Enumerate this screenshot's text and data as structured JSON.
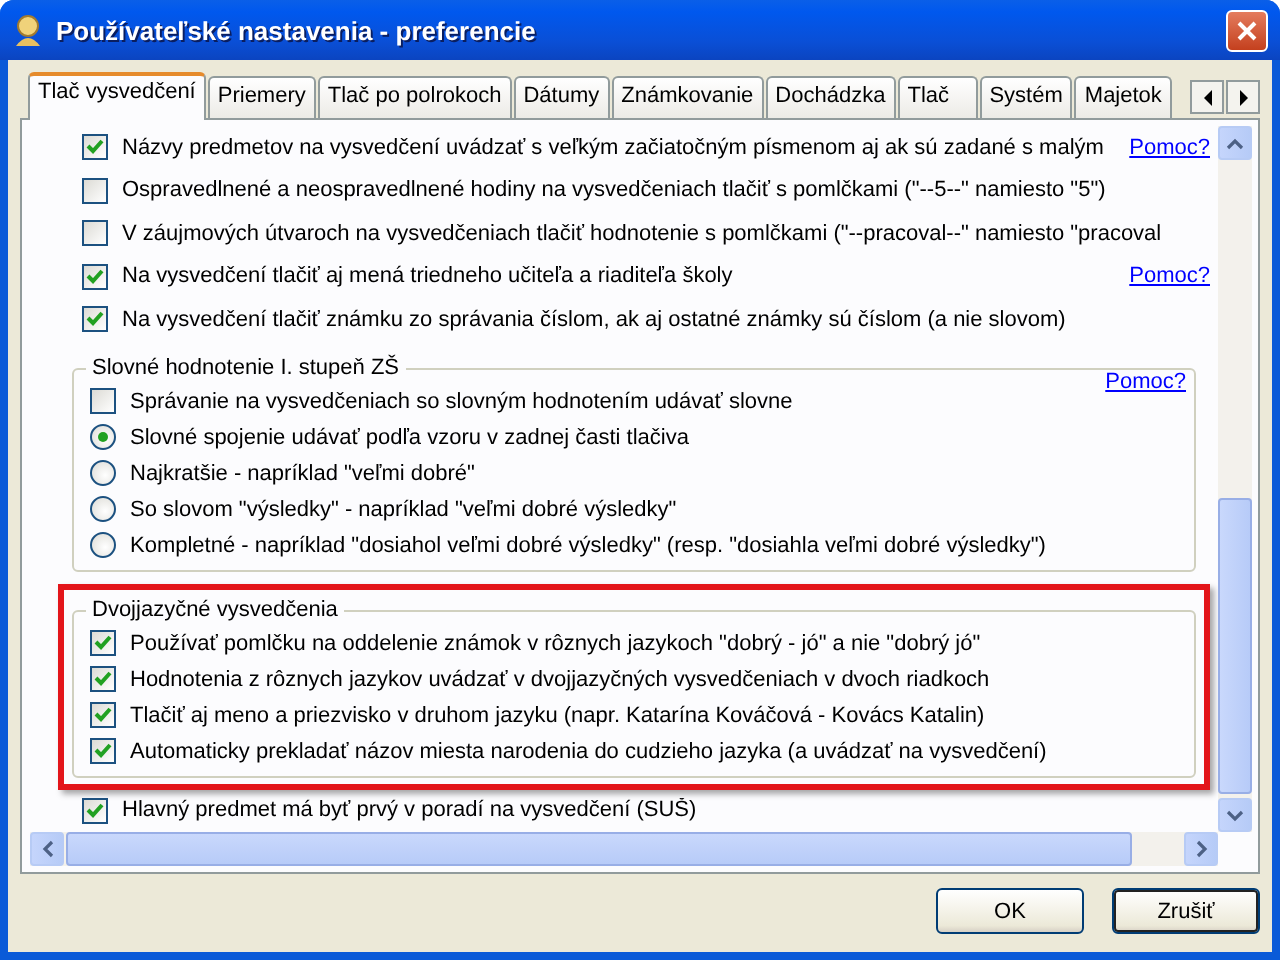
{
  "window": {
    "title": "Používateľské nastavenia - preferencie"
  },
  "tabs": [
    {
      "label": "Tlač vysvedčení",
      "selected": true
    },
    {
      "label": "Priemery",
      "selected": false
    },
    {
      "label": "Tlač po polrokoch",
      "selected": false
    },
    {
      "label": "Dátumy",
      "selected": false
    },
    {
      "label": "Známkovanie",
      "selected": false
    },
    {
      "label": "Dochádzka",
      "selected": false
    },
    {
      "label": "Tlač",
      "selected": false
    },
    {
      "label": "Systém",
      "selected": false
    },
    {
      "label": "Majetok",
      "selected": false
    }
  ],
  "sections": [
    {
      "kind": "plain",
      "items": [
        {
          "kind": "checkbox",
          "label": "Názvy predmetov na vysvedčení uvádzať s veľkým začiatočným písmenom aj ak sú zadané s malým",
          "checked": true,
          "help": "Pomoc?"
        },
        {
          "kind": "checkbox",
          "label": "Ospravedlnené a neospravedlnené hodiny na vysvedčeniach tlačiť s pomlčkami (\"--5--\" namiesto \"5\")",
          "checked": false
        },
        {
          "kind": "checkbox",
          "label": "V záujmových útvaroch na vysvedčeniach tlačiť hodnotenie s pomlčkami (\"--pracoval--\" namiesto \"pracoval",
          "checked": false
        },
        {
          "kind": "checkbox",
          "label": "Na vysvedčení tlačiť aj mená triedneho učiteľa a riaditeľa školy",
          "checked": true,
          "help": "Pomoc?"
        },
        {
          "kind": "checkbox",
          "label": "Na vysvedčení tlačiť známku zo správania číslom, ak aj ostatné známky sú číslom (a nie slovom)",
          "checked": true
        }
      ]
    },
    {
      "kind": "group",
      "title": "Slovné hodnotenie I. stupeň ZŠ",
      "help": "Pomoc?",
      "highlighted": false,
      "items": [
        {
          "kind": "checkbox",
          "label": "Správanie na vysvedčeniach so slovným hodnotením udávať slovne",
          "checked": false
        },
        {
          "kind": "radio",
          "label": "Slovné spojenie udávať podľa vzoru v zadnej časti tlačiva",
          "selected": true
        },
        {
          "kind": "radio",
          "label": "Najkratšie - napríklad \"veľmi dobré\"",
          "selected": false
        },
        {
          "kind": "radio",
          "label": "So slovom \"výsledky\" - napríklad \"veľmi dobré výsledky\"",
          "selected": false
        },
        {
          "kind": "radio",
          "label": "Kompletné - napríklad \"dosiahol veľmi dobré výsledky\" (resp. \"dosiahla veľmi dobré výsledky\")",
          "selected": false
        }
      ]
    },
    {
      "kind": "group",
      "title": "Dvojjazyčné vysvedčenia",
      "highlighted": true,
      "items": [
        {
          "kind": "checkbox",
          "label": "Používať pomlčku na oddelenie známok v rôznych jazykoch \"dobrý - jó\" a nie \"dobrý jó\"",
          "checked": true
        },
        {
          "kind": "checkbox",
          "label": "Hodnotenia z rôznych jazykov uvádzať v dvojjazyčných vysvedčeniach v dvoch riadkoch",
          "checked": true
        },
        {
          "kind": "checkbox",
          "label": "Tlačiť aj meno a priezvisko v druhom jazyku (napr. Katarína Kováčová - Kovács Katalin)",
          "checked": true
        },
        {
          "kind": "checkbox",
          "label": "Automaticky prekladať názov miesta narodenia do cudzieho jazyka (a uvádzať na vysvedčení)",
          "checked": true
        }
      ]
    },
    {
      "kind": "plain",
      "items": [
        {
          "kind": "checkbox",
          "label": "Hlavný predmet má byť prvý v poradí na vysvedčení (SUŠ)",
          "checked": true
        }
      ]
    }
  ],
  "buttons": [
    {
      "label": "OK",
      "default": false
    },
    {
      "label": "Zrušiť",
      "default": true
    }
  ]
}
